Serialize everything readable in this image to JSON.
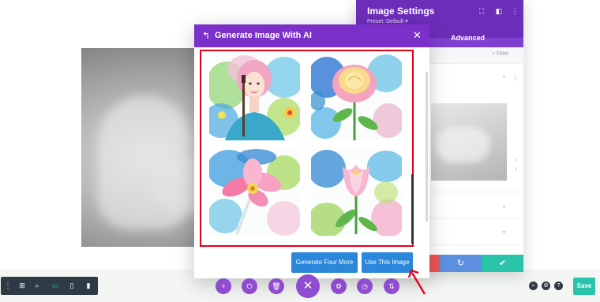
{
  "settings_panel": {
    "title": "Image Settings",
    "preset": "Preset: Default ▾",
    "tab_advanced": "Advanced",
    "filter_label": "+ Filter",
    "side_text_1": "t",
    "side_text_2": "t",
    "footer_icons": [
      "close-icon",
      "undo-icon",
      "check-icon"
    ]
  },
  "modal": {
    "title": "Generate Image With AI",
    "back_icon": "↰",
    "close_icon": "✕",
    "images": [
      "girl-painter",
      "rose",
      "pink-flower",
      "tulip"
    ],
    "generate_more_label": "Generate Four More",
    "use_image_label": "Use This Image"
  },
  "toolbar": {
    "save_label": "Save",
    "left_icons": [
      "more-icon",
      "wireframe-icon",
      "zoom-icon",
      "desktop-icon",
      "tablet-icon",
      "phone-icon"
    ],
    "center_icons": [
      "add-icon",
      "power-icon",
      "trash-icon",
      "close-icon",
      "settings-icon",
      "history-icon",
      "portability-icon"
    ],
    "right_icons": [
      "search-icon",
      "settings-icon",
      "help-icon"
    ]
  },
  "colors": {
    "purple_header": "#7a30c9",
    "settings_header": "#6c2eb9",
    "highlight_border": "#e3001b",
    "button_blue": "#2b87da",
    "save_green": "#29c4a9",
    "footer_red": "#ef5555",
    "footer_blue": "#5c8fe0",
    "footer_green": "#29c4a9"
  }
}
